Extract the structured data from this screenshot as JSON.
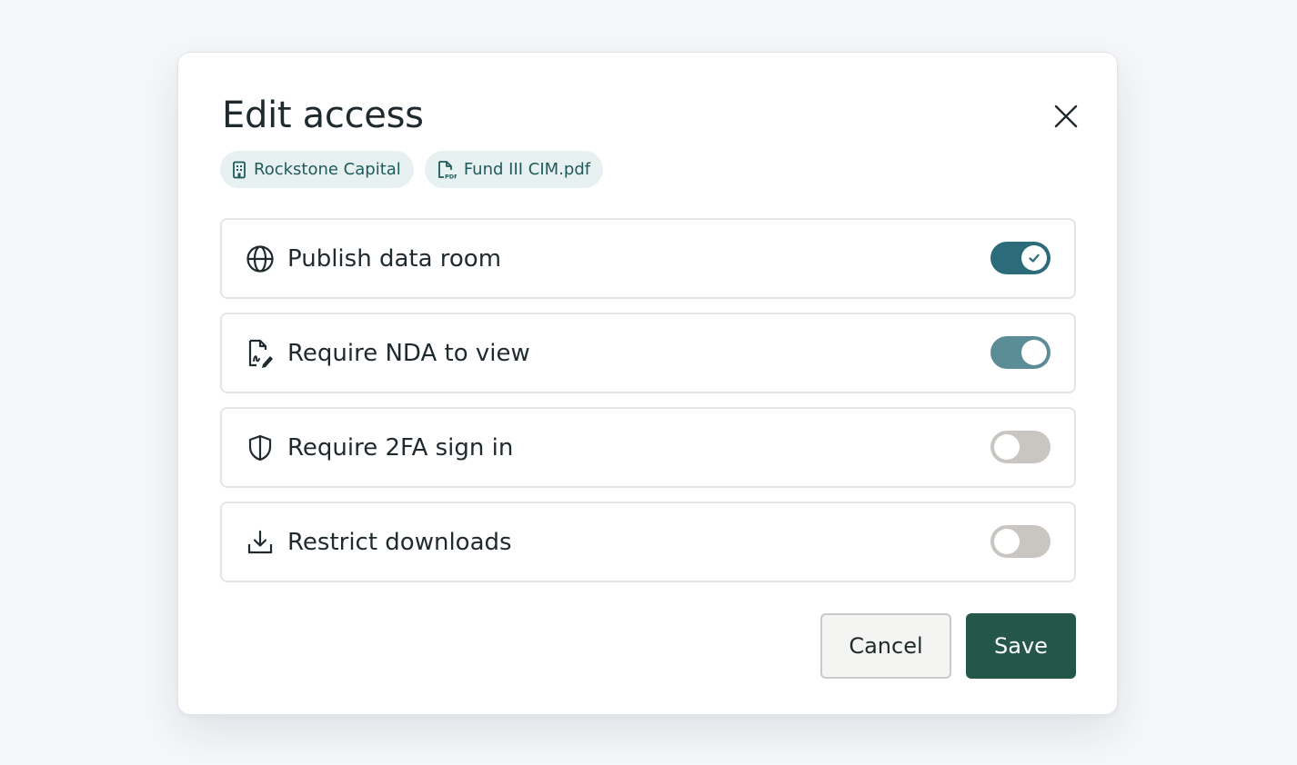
{
  "modal": {
    "title": "Edit access",
    "chips": [
      {
        "label": "Rockstone Capital",
        "icon": "building-icon"
      },
      {
        "label": "Fund III CIM.pdf",
        "icon": "pdf-file-icon"
      }
    ],
    "settings": [
      {
        "label": "Publish data room",
        "icon": "globe-icon",
        "state": "on",
        "enabled": true
      },
      {
        "label": "Require NDA to view",
        "icon": "signed-document-icon",
        "state": "on",
        "enabled": true
      },
      {
        "label": "Require 2FA sign in",
        "icon": "shield-icon",
        "state": "off",
        "enabled": false
      },
      {
        "label": "Restrict downloads",
        "icon": "download-icon",
        "state": "off",
        "enabled": false
      }
    ],
    "cancel_label": "Cancel",
    "save_label": "Save"
  },
  "colors": {
    "accent_toggle": "#2b6b7a",
    "accent_toggle_muted": "#5b8d96",
    "toggle_off": "#c9c6c2",
    "save_button": "#24574a",
    "chip_bg": "#e8f1f1",
    "chip_text": "#1f5a5a"
  }
}
